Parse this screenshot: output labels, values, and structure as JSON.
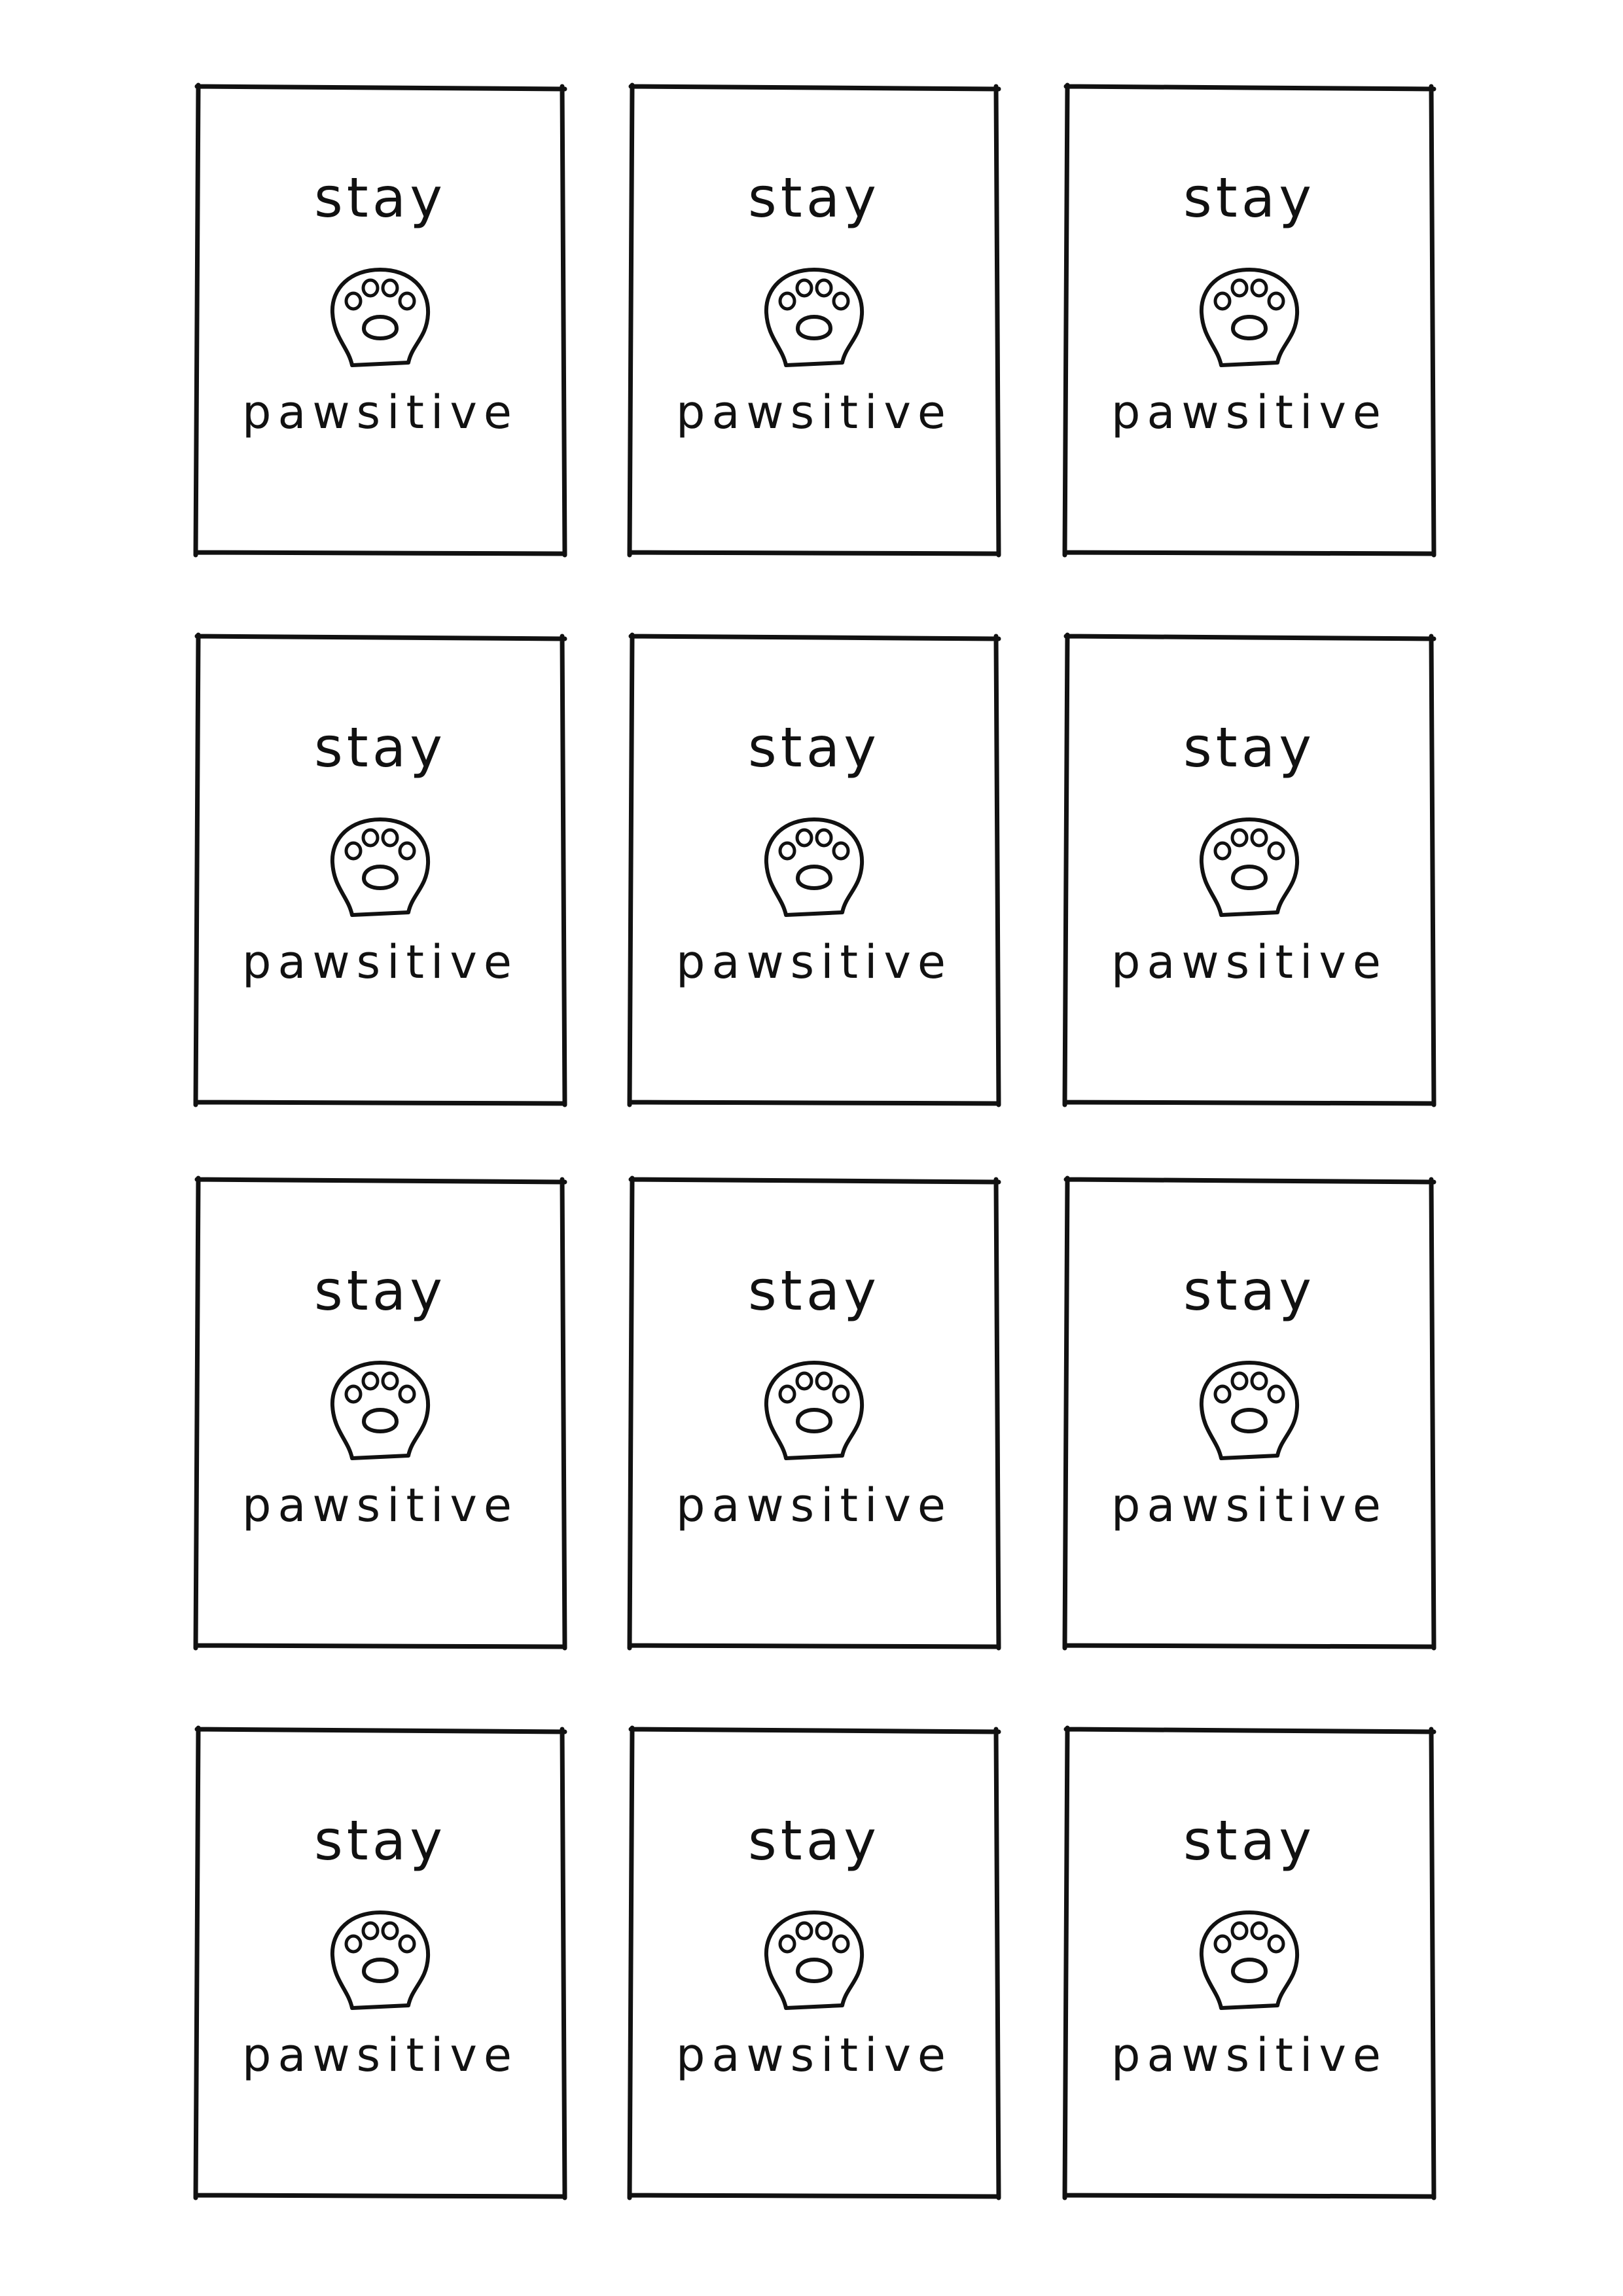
{
  "sheet": {
    "ink_color": "#111111",
    "background_color": "#ffffff",
    "icon": "cat-paw-icon",
    "cards": [
      {
        "top_text": "stay",
        "bottom_text": "pawsitive"
      },
      {
        "top_text": "stay",
        "bottom_text": "pawsitive"
      },
      {
        "top_text": "stay",
        "bottom_text": "pawsitive"
      },
      {
        "top_text": "stay",
        "bottom_text": "pawsitive"
      },
      {
        "top_text": "stay",
        "bottom_text": "pawsitive"
      },
      {
        "top_text": "stay",
        "bottom_text": "pawsitive"
      },
      {
        "top_text": "stay",
        "bottom_text": "pawsitive"
      },
      {
        "top_text": "stay",
        "bottom_text": "pawsitive"
      },
      {
        "top_text": "stay",
        "bottom_text": "pawsitive"
      },
      {
        "top_text": "stay",
        "bottom_text": "pawsitive"
      },
      {
        "top_text": "stay",
        "bottom_text": "pawsitive"
      },
      {
        "top_text": "stay",
        "bottom_text": "pawsitive"
      }
    ]
  }
}
